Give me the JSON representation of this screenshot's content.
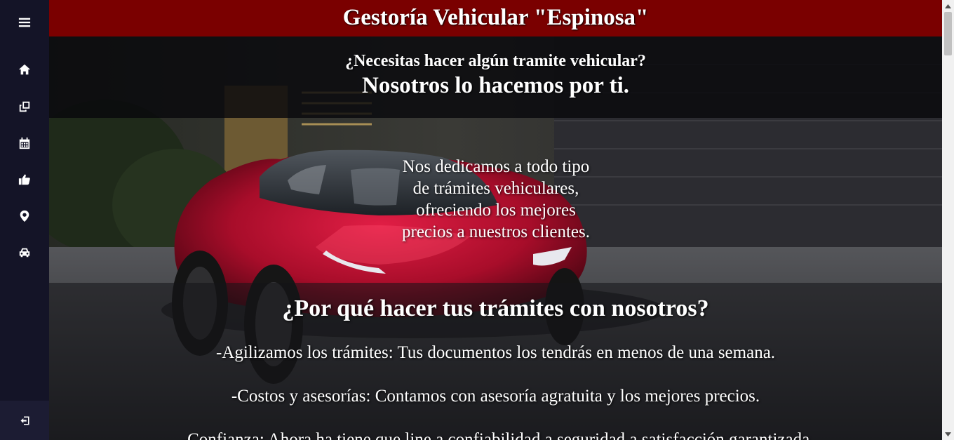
{
  "header": {
    "title": "Gestoría Vehicular \"Espinosa\""
  },
  "banner": {
    "question": "¿Necesitas hacer algún tramite vehicular?",
    "answer": "Nosotros lo hacemos por ti."
  },
  "intro": {
    "lines": [
      "Nos dedicamos a todo tipo",
      "de trámites vehiculares,",
      "ofreciendo los mejores",
      "precios a nuestros clientes."
    ]
  },
  "why": {
    "title": "¿Por qué hacer tus trámites con nosotros?",
    "items": [
      "-Agilizamos los trámites: Tus documentos los tendrás en menos de una semana.",
      "-Costos y asesorías: Contamos con asesoría agratuita y los mejores precios.",
      "-Confianza: Ahora ha tiene que line a confiabilidad a seguridad a satisfacción garantizada"
    ]
  },
  "sidebar": {
    "items": [
      {
        "icon": "menu-icon"
      },
      {
        "icon": "home-icon"
      },
      {
        "icon": "copy-icon"
      },
      {
        "icon": "calendar-icon"
      },
      {
        "icon": "thumbs-up-icon"
      },
      {
        "icon": "location-icon"
      },
      {
        "icon": "car-icon"
      },
      {
        "icon": "logout-icon"
      }
    ]
  },
  "colors": {
    "header": "#7a0000",
    "sidebar": "#141427",
    "text": "#ffffff"
  }
}
